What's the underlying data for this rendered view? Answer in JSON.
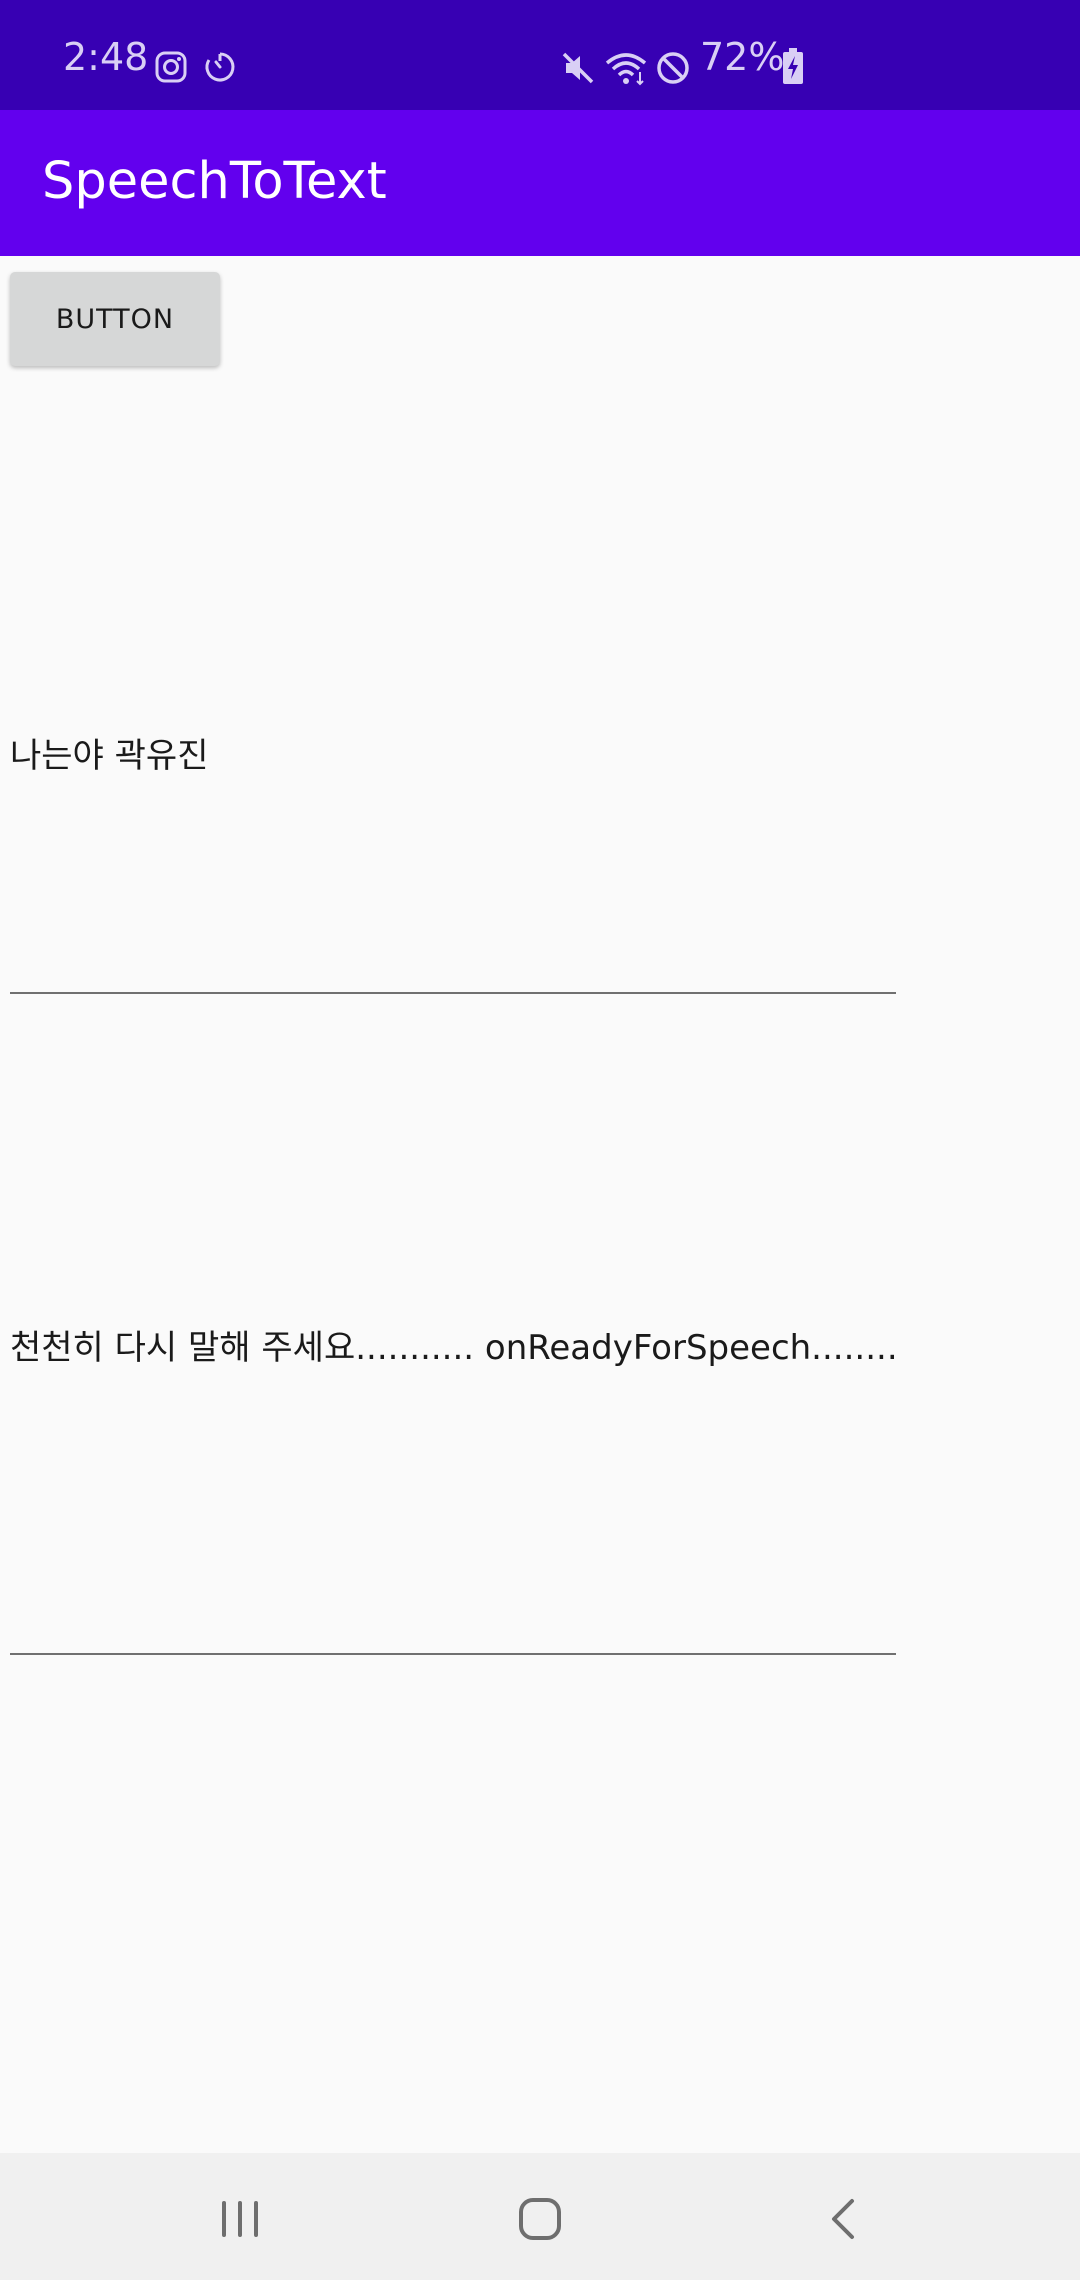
{
  "status_bar": {
    "time": "2:48",
    "battery": "72%",
    "icons": [
      "instagram-icon",
      "timer-icon",
      "mute-icon",
      "wifi-icon",
      "do-not-disturb-icon",
      "battery-charging-icon"
    ]
  },
  "app_bar": {
    "title": "SpeechToText"
  },
  "main": {
    "button_label": "BUTTON",
    "result_text": "나는야 곽유진",
    "edit_text": "천천히 다시 말해 주세요........... onReadyForSpeech........... onEndOfSpeech"
  },
  "nav_bar": {
    "icons": [
      "recent-apps-icon",
      "home-icon",
      "back-icon"
    ]
  },
  "colors": {
    "status_bar": "#3700B3",
    "app_bar": "#6200EE",
    "background": "#FAFAFA"
  }
}
